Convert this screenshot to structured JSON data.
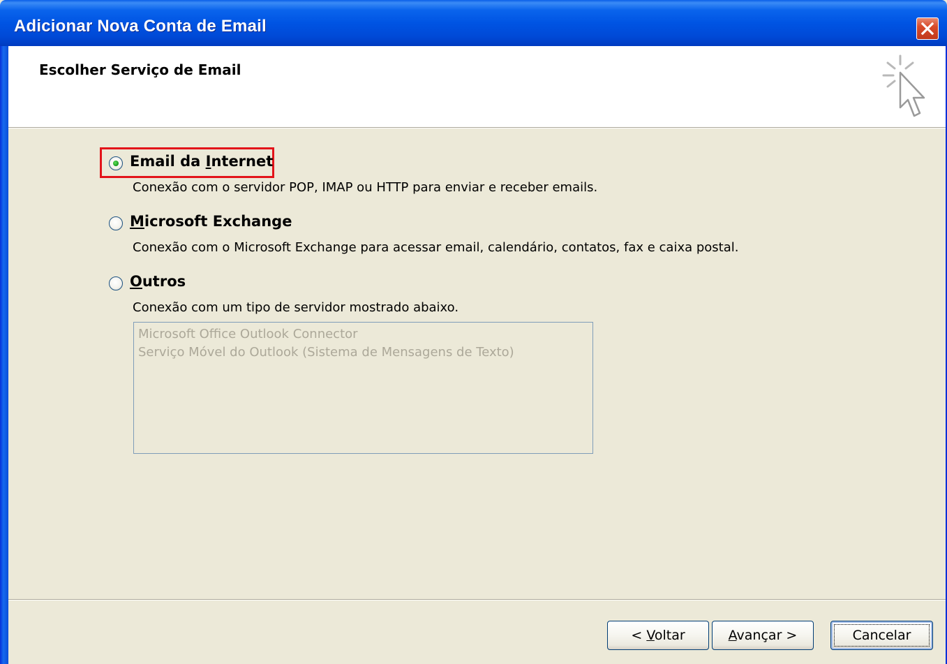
{
  "window": {
    "title": "Adicionar Nova Conta de Email",
    "close_icon": "close-icon"
  },
  "header": {
    "subtitle": "Escolher Serviço de Email",
    "icon": "wizard-sparkle-cursor-icon"
  },
  "options": [
    {
      "label_pre": "Email da ",
      "label_accel": "I",
      "label_post": "nternet",
      "description": "Conexão com o servidor POP, IMAP ou HTTP para enviar e receber emails.",
      "selected": true,
      "highlighted": true
    },
    {
      "label_pre": "",
      "label_accel": "M",
      "label_post": "icrosoft Exchange",
      "description": "Conexão com o Microsoft Exchange para acessar email, calendário, contatos, fax e caixa postal.",
      "selected": false
    },
    {
      "label_pre": "",
      "label_accel": "O",
      "label_post": "utros",
      "description": "Conexão com um tipo de servidor mostrado abaixo.",
      "selected": false
    }
  ],
  "other_servers": [
    "Microsoft Office Outlook Connector",
    "Serviço Móvel do Outlook (Sistema de Mensagens de Texto)"
  ],
  "buttons": {
    "back": {
      "pre": "< ",
      "accel": "V",
      "post": "oltar"
    },
    "next": {
      "pre": "",
      "accel": "A",
      "post": "vançar >"
    },
    "cancel": {
      "label": "Cancelar"
    }
  },
  "colors": {
    "highlight_border": "#e3141a",
    "titlebar": "#0054e3",
    "dialog_bg": "#ece9d8"
  }
}
